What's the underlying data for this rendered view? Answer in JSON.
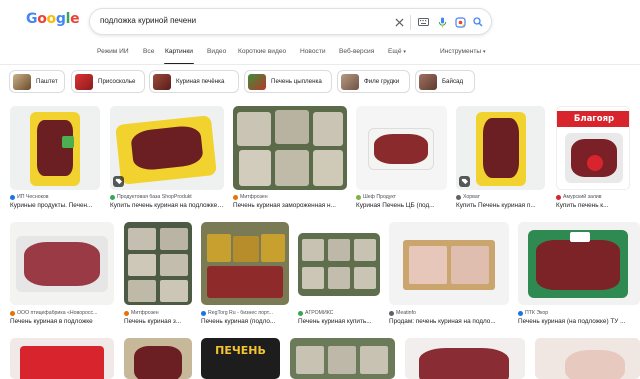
{
  "search": {
    "query": "подложка куриной печени"
  },
  "tabs": [
    {
      "label": "Режим ИИ"
    },
    {
      "label": "Все"
    },
    {
      "label": "Картинки"
    },
    {
      "label": "Видео"
    },
    {
      "label": "Короткие видео"
    },
    {
      "label": "Новости"
    },
    {
      "label": "Веб-версия"
    },
    {
      "label": "Ещё"
    },
    {
      "label": "Инструменты"
    }
  ],
  "active_tab": "Картинки",
  "chips": [
    {
      "label": "Паштет"
    },
    {
      "label": "Присосколье"
    },
    {
      "label": "Куриная печёнка"
    },
    {
      "label": "Печень цыпленка"
    },
    {
      "label": "Филе грудки"
    },
    {
      "label": "Байсад"
    }
  ],
  "row1": [
    {
      "source": "ИП Чесноков",
      "caption": "Куриные продукты. Печен..."
    },
    {
      "source": "Продуктовая база ShopProdukt",
      "caption": "Купить печень куриная на подложке, ..."
    },
    {
      "source": "Митфрозен",
      "caption": "Печень куриная замороженная н..."
    },
    {
      "source": "Шеф Продукт",
      "caption": "Куриная Печень ЦБ (под..."
    },
    {
      "source": "Хорват",
      "caption": "Купить Печень куриная п..."
    },
    {
      "source": "Амурский залив",
      "caption": "Купить печень к..."
    }
  ],
  "row2": [
    {
      "source": "ООО птицефабрика «Новоросс...",
      "caption": "Печень куриная в подложке"
    },
    {
      "source": "Митфрозен",
      "caption": "Печень куриная з..."
    },
    {
      "source": "RegTorg Ru - бизнес порт...",
      "caption": "Печень куриная (подло..."
    },
    {
      "source": "АГРОМИКС",
      "caption": "Печень куриная купить..."
    },
    {
      "source": "Meatinfo",
      "caption": "Продам: печень куриная на подло..."
    },
    {
      "source": "ПТК Экор",
      "caption": "Печень куриная (на подложке) ТУ ..."
    }
  ],
  "row1_label_brand": "Благояр",
  "row3_label": "ПЕЧЕНЬ",
  "colors": {
    "accent_blue": "#1a73e8",
    "tray_yellow": "#f2d22e",
    "liver": "#6b1f22",
    "brand_red": "#d8242d"
  }
}
